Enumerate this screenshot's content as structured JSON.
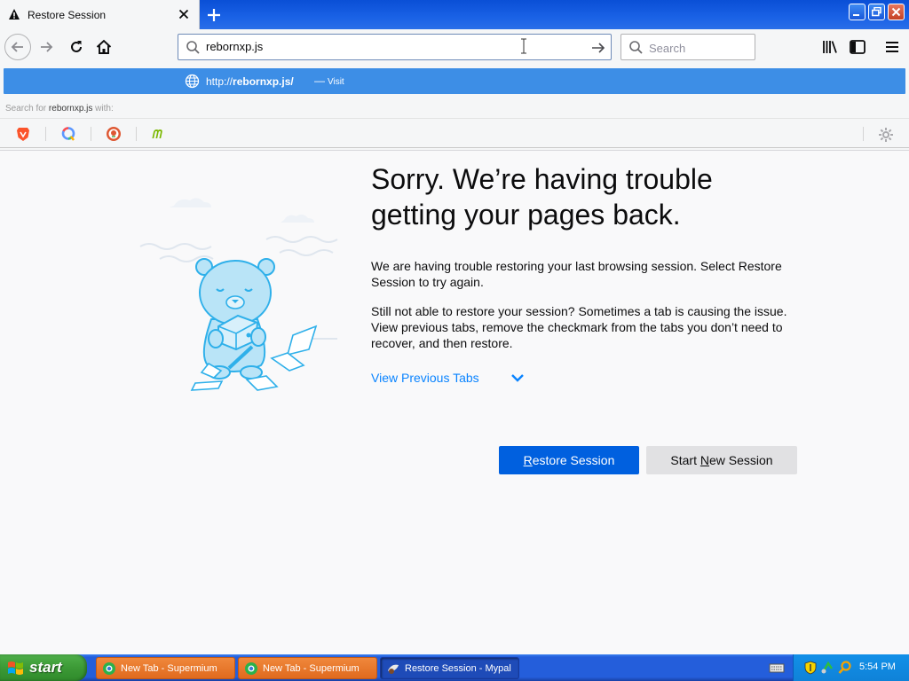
{
  "colors": {
    "accent": "#0060df",
    "link": "#0a84ff",
    "suggestion_bg": "#3d8ee6"
  },
  "tab": {
    "title": "Restore Session",
    "icon": "warning-icon"
  },
  "navbar": {
    "url_value": "rebornxp.js",
    "search_placeholder": "Search"
  },
  "url_popup": {
    "suggestion_url_prefix": "http://",
    "suggestion_url_bold": "rebornxp.js/",
    "suggestion_dash": "—",
    "suggestion_action": "Visit",
    "search_for_prefix": "Search for ",
    "search_for_term": "rebornxp.js",
    "search_for_suffix": " with:",
    "engines": [
      "brave-icon",
      "qwant-icon",
      "duckduckgo-icon",
      "mojeek-icon"
    ]
  },
  "content": {
    "heading": "Sorry. We’re having trouble getting your pages back.",
    "para1": "We are having trouble restoring your last browsing session. Select Restore Session to try again.",
    "para2": "Still not able to restore your session? Sometimes a tab is causing the issue. View previous tabs, remove the checkmark from the tabs you don’t need to recover, and then restore.",
    "view_tabs": "View Previous Tabs",
    "restore_pre": "",
    "restore_ul": "R",
    "restore_post": "estore Session",
    "new_pre": "Start ",
    "new_ul": "N",
    "new_post": "ew Session"
  },
  "taskbar": {
    "start": "start",
    "tasks": [
      {
        "label": "New Tab - Supermium",
        "state": "inactive"
      },
      {
        "label": "New Tab - Supermium",
        "state": "inactive"
      },
      {
        "label": "Restore Session - Mypal",
        "state": "active"
      }
    ],
    "clock": "5:54 PM"
  }
}
